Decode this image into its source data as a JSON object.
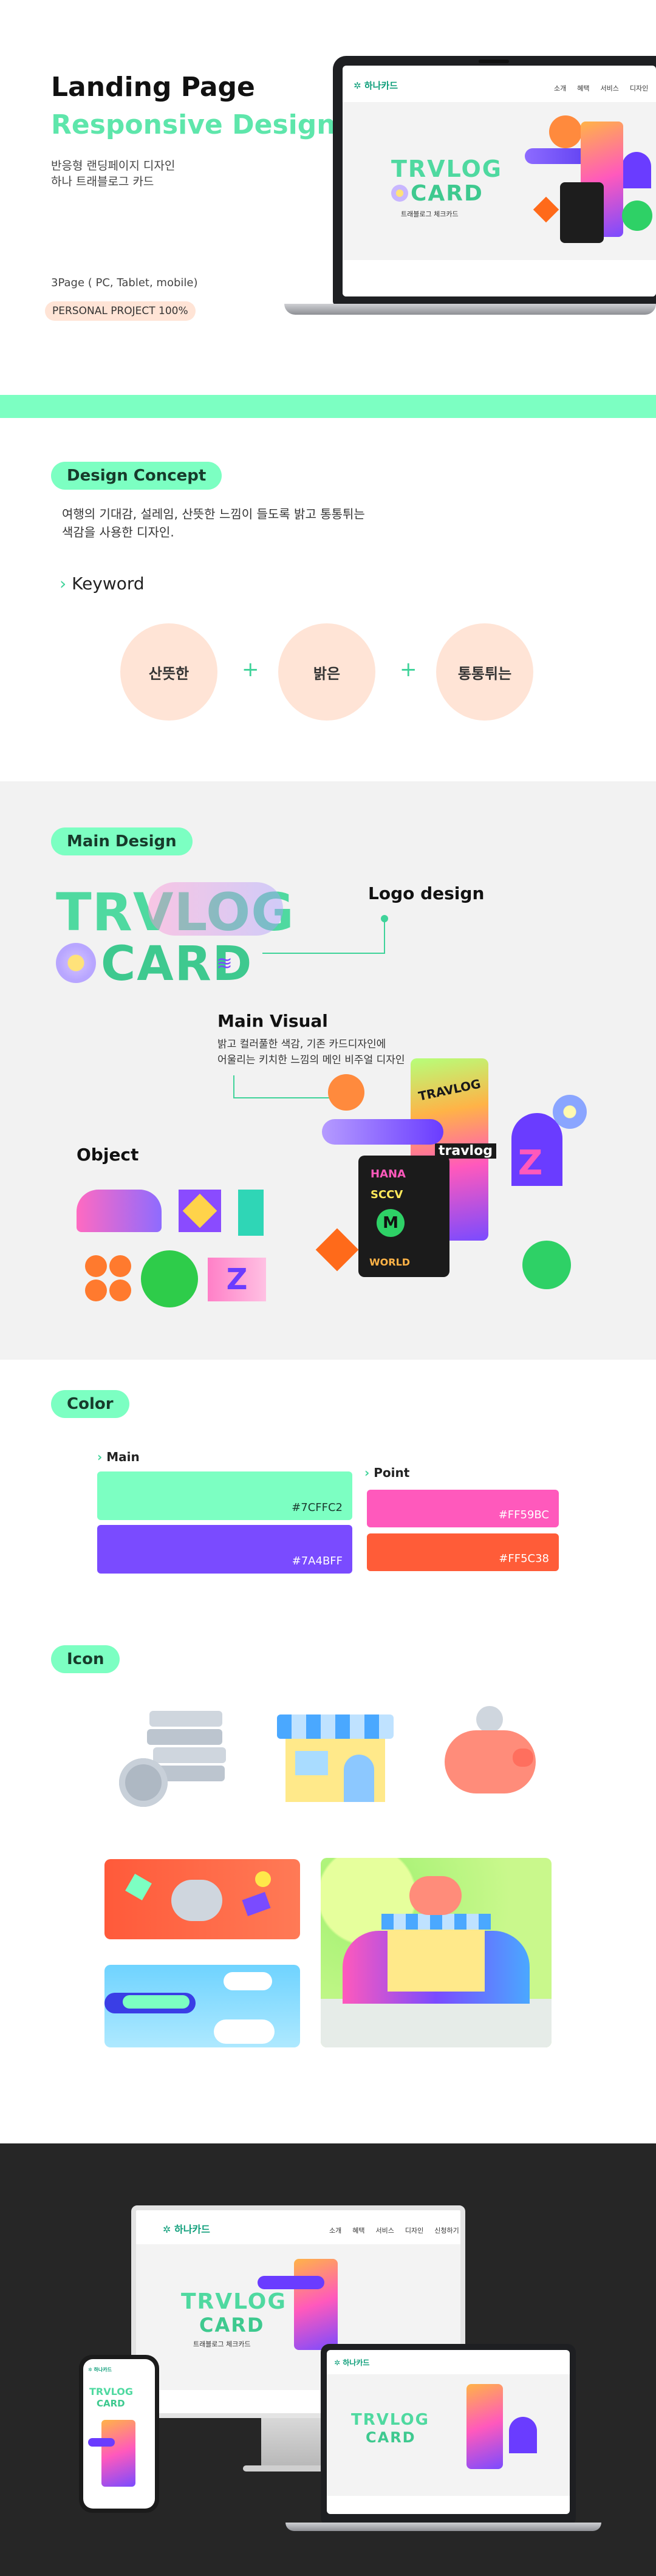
{
  "hero": {
    "title_line1": "Landing Page",
    "title_line2": "Responsive Design",
    "desc_line1": "반응형 랜딩페이지 디자인",
    "desc_line2": "하나 트래블로그 카드",
    "pages": "3Page ( PC, Tablet, mobile)",
    "badge": "PERSONAL PROJECT 100%"
  },
  "site": {
    "brand": "하나카드",
    "nav": [
      "소개",
      "혜택",
      "서비스",
      "디자인"
    ],
    "nav_extended": [
      "소개",
      "혜택",
      "서비스",
      "디자인",
      "신청하기"
    ],
    "logo_top": "TRVLOG",
    "logo_bottom": "CARD",
    "tagline": "트래블로그 체크카드"
  },
  "concept": {
    "label": "Design Concept",
    "desc_line1": "여행의 기대감, 설레임, 산뜻한 느낌이 들도록 밝고 통통튀는",
    "desc_line2": "색감을 사용한 디자인.",
    "keyword_title": "Keyword",
    "keywords": [
      "산뜻한",
      "밝은",
      "통통튀는"
    ],
    "plus": "+"
  },
  "main_design": {
    "label": "Main Design",
    "logo_design": "Logo design",
    "main_visual": "Main Visual",
    "mv_desc_line1": "밝고 컬러풀한 색감, 기존 카드디자인에",
    "mv_desc_line2": "어울리는 키치한 느낌의 메인 비주얼 디자인",
    "object": "Object",
    "card_words": [
      "TRAVLOG",
      "SCCV",
      "travlog",
      "WORLD",
      "M",
      "HANA"
    ]
  },
  "color": {
    "label": "Color",
    "main_label": "Main",
    "point_label": "Point",
    "main": [
      {
        "hex": "#7CFFC2"
      },
      {
        "hex": "#7A4BFF"
      }
    ],
    "point": [
      {
        "hex": "#FF59BC"
      },
      {
        "hex": "#FF5C38"
      }
    ]
  },
  "icon": {
    "label": "Icon"
  },
  "colors": {
    "mint": "#7CFFC2",
    "purple": "#7A4BFF",
    "pink": "#FF59BC",
    "orange": "#FF5C38"
  }
}
